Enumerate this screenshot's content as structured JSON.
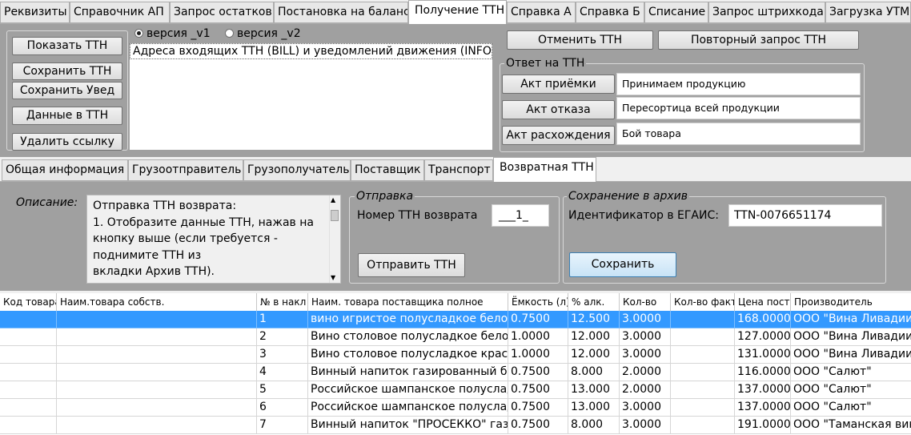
{
  "main_tabs": [
    "Реквизиты",
    "Справочник АП",
    "Запрос остатков",
    "Постановка на баланс",
    "Получение ТТН",
    "Справка А",
    "Справка Б",
    "Списание",
    "Запрос штрихкода",
    "Загрузка УТМ"
  ],
  "active_main_tab": "Получение ТТН",
  "left_buttons": {
    "show_ttn": "Показать ТТН",
    "save_ttn": "Сохранить ТТН",
    "save_notice": "Сохранить Увед",
    "data_to_ttn": "Данные в ТТН",
    "delete_link": "Удалить ссылку"
  },
  "version_radios": {
    "v1": "версия _v1",
    "v2": "версия _v2",
    "selected": "v1"
  },
  "address_list_item": "Адреса входящих ТТН (BILL) и уведомлений движения (INFO)",
  "right_buttons": {
    "cancel_ttn": "Отменить ТТН",
    "repeat_request": "Повторный запрос ТТН"
  },
  "reply_group": {
    "legend": "Ответ на ТТН",
    "rows": [
      {
        "button": "Акт приёмки",
        "value": "Принимаем продукцию"
      },
      {
        "button": "Акт отказа",
        "value": "Пересортица всей продукции"
      },
      {
        "button": "Акт расхождения",
        "value": "Бой товара"
      }
    ]
  },
  "sub_tabs": [
    "Общая информация",
    "Грузоотправитель",
    "Грузополучатель",
    "Поставщик",
    "Транспорт",
    "Возвратная ТТН"
  ],
  "active_sub_tab": "Возвратная ТТН",
  "description": {
    "label": "Описание:",
    "lines": [
      "Отправка ТТН возврата:",
      "1. Отобразите данные ТТН, нажав на",
      "кнопку выше (если требуется -",
      "поднимите ТТН из",
      "вкладки Архив ТТН)."
    ]
  },
  "send_group": {
    "legend": "Отправка",
    "label": "Номер ТТН возврата",
    "value": "___1_",
    "button": "Отправить ТТН"
  },
  "archive_group": {
    "legend": "Сохранение в архив",
    "label": "Идентификатор в ЕГАИС:",
    "value": "TTN-0076651174",
    "button": "Сохранить"
  },
  "table": {
    "columns": [
      "Код товара",
      "Наим.товара собств.",
      "№ в накл",
      "Наим. товара поставщика полное",
      "Ёмкость (л)",
      "% алк.",
      "Кол-во",
      "Кол-во факт",
      "Цена пост.",
      "Производитель"
    ],
    "rows": [
      [
        "",
        "",
        "1",
        "вино игристое полусладкое белое",
        "0.7500",
        "12.500",
        "3.0000",
        "",
        "168.0000",
        "ООО \"Вина Ливадии\""
      ],
      [
        "",
        "",
        "2",
        "Вино столовое полусладкое белое",
        "1.0000",
        "12.000",
        "3.0000",
        "",
        "127.0000",
        "ООО \"Вина Ливадии\""
      ],
      [
        "",
        "",
        "3",
        "Вино столовое полусладкое красное",
        "1.0000",
        "12.000",
        "3.0000",
        "",
        "131.0000",
        "ООО \"Вина Ливадии\""
      ],
      [
        "",
        "",
        "4",
        "Винный напиток газированный белый",
        "0.7500",
        "8.000",
        "2.0000",
        "",
        "116.0000",
        "ООО \"Салют\""
      ],
      [
        "",
        "",
        "5",
        "Российское шампанское полусладкое",
        "0.7500",
        "13.000",
        "2.0000",
        "",
        "137.0000",
        "ООО \"Салют\""
      ],
      [
        "",
        "",
        "6",
        "Российское шампанское полусладкое",
        "0.7500",
        "13.000",
        "3.0000",
        "",
        "137.0000",
        "ООО \"Салют\""
      ],
      [
        "",
        "",
        "7",
        "Винный напиток \"ПРОСЕККО\" газированный",
        "0.7500",
        "8.000",
        "3.0000",
        "",
        "191.0000",
        "ООО \"Таманская вин"
      ]
    ],
    "selected_row": 0
  }
}
